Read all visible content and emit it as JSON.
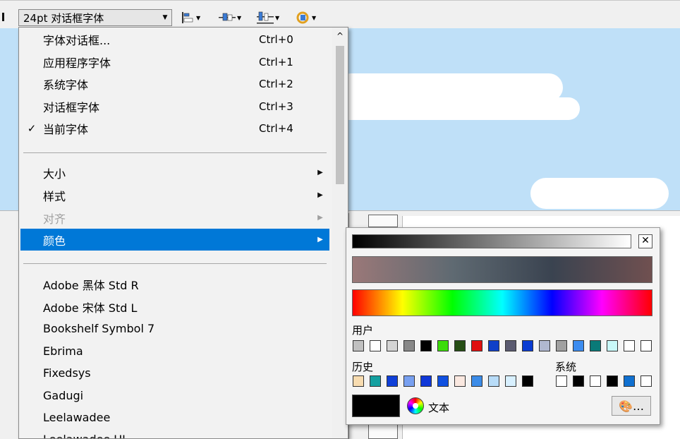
{
  "toolbar": {
    "font_combo_value": "24pt 对话框字体",
    "icons": [
      "align-left-icon",
      "align-center-icon",
      "distribute-icon",
      "rotate-icon"
    ]
  },
  "menu": {
    "items": [
      {
        "label": "字体对话框...",
        "shortcut": "Ctrl+0"
      },
      {
        "label": "应用程序字体",
        "shortcut": "Ctrl+1"
      },
      {
        "label": "系统字体",
        "shortcut": "Ctrl+2"
      },
      {
        "label": "对话框字体",
        "shortcut": "Ctrl+3"
      },
      {
        "label": "当前字体",
        "shortcut": "Ctrl+4",
        "check": "✓"
      }
    ],
    "submenus": [
      {
        "label": "大小"
      },
      {
        "label": "样式"
      },
      {
        "label": "对齐",
        "disabled": true
      },
      {
        "label": "颜色",
        "highlighted": true
      }
    ],
    "fonts": [
      "Adobe 黑体 Std R",
      "Adobe 宋体 Std L",
      "Bookshelf Symbol 7",
      "Ebrima",
      "Fixedsys",
      "Gadugi",
      "Leelawadee",
      "Leelawadee UI"
    ]
  },
  "color_popup": {
    "close_glyph": "✕",
    "user_label": "用户",
    "history_label": "历史",
    "system_label": "系统",
    "text_label": "文本",
    "palette_button": "🎨…",
    "user_colors": [
      "#c0c0c0",
      "#ffffff",
      "#d4d4d4",
      "#888888",
      "#000000",
      "#3cdc0a",
      "#254d14",
      "#e01010",
      "#1040c8",
      "#5a5a70",
      "#0a3cd2",
      "#b0b8d0",
      "#a0a0a0",
      "#3c8cf0",
      "#0a7a78",
      "#c8f8f8",
      "#ffffff",
      "#ffffff"
    ],
    "history_colors": [
      "#f8dcb0",
      "#14a0a0",
      "#1040d8",
      "#78a0f0",
      "#1038d8",
      "#1050e0",
      "#fae8e0",
      "#3c8ce8",
      "#b8dcf8",
      "#d8f0ff",
      "#000000"
    ],
    "system_colors": [
      "#ffffff",
      "#000000",
      "#ffffff",
      "#000000",
      "#1070d0",
      "#ffffff"
    ],
    "current_color": "#000000"
  }
}
